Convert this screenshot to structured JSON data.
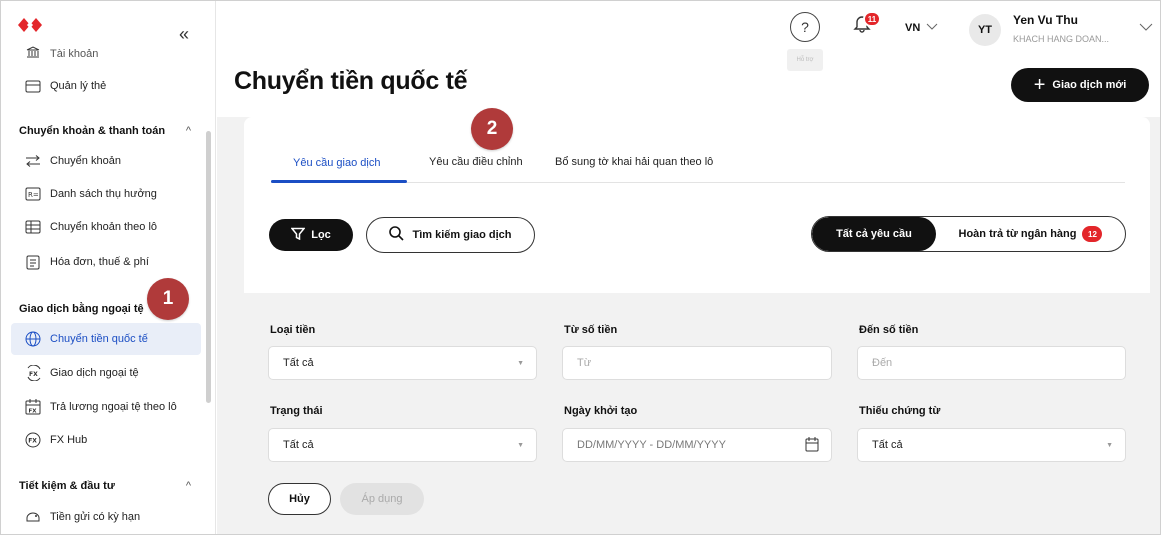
{
  "sidebar": {
    "items": [
      {
        "label": "Tài khoản",
        "icon": "bank-icon"
      },
      {
        "label": "Quản lý thẻ",
        "icon": "card-icon"
      },
      {
        "label": "Chuyển khoản",
        "icon": "transfer-arrows-icon"
      },
      {
        "label": "Danh sách thụ hưởng",
        "icon": "beneficiary-list-icon"
      },
      {
        "label": "Chuyển khoản theo lô",
        "icon": "batch-table-icon"
      },
      {
        "label": "Hóa đơn, thuế & phí",
        "icon": "bill-icon"
      },
      {
        "label": "Chuyển tiền quốc tế",
        "icon": "globe-icon"
      },
      {
        "label": "Giao dịch ngoại tệ",
        "icon": "fx-exchange-icon"
      },
      {
        "label": "Trả lương ngoại tệ theo lô",
        "icon": "fx-calendar-icon"
      },
      {
        "label": "FX Hub",
        "icon": "fx-circle-icon"
      },
      {
        "label": "Tiền gửi có kỳ hạn",
        "icon": "deposit-icon"
      }
    ],
    "sections": [
      {
        "title": "Chuyển khoản & thanh toán",
        "chevron": "^"
      },
      {
        "title": "Giao dịch bằng ngoại tệ",
        "chevron": ""
      },
      {
        "title": "Tiết kiệm & đầu tư",
        "chevron": "^"
      }
    ],
    "collapse": "«"
  },
  "header": {
    "help_symbol": "?",
    "help_tooltip": "Hỗ trợ",
    "notif_count": "11",
    "lang": "VN",
    "avatar": "YT",
    "user_name": "Yen Vu Thu",
    "user_role": "KHACH HANG DOAN..."
  },
  "page": {
    "title": "Chuyển tiền quốc tế",
    "new_button": "Giao dịch mới"
  },
  "tabs": [
    "Yêu cầu giao dịch",
    "Yêu cầu điều chỉnh",
    "Bổ sung tờ khai hải quan theo lô"
  ],
  "toolbar": {
    "filter": "Lọc",
    "search": "Tìm kiếm giao dịch",
    "seg_all": "Tất cả yêu cầu",
    "seg_refund": "Hoàn trả từ ngân hàng",
    "refund_count": "12"
  },
  "form": {
    "currency_label": "Loại tiền",
    "currency_value": "Tất cả",
    "from_label": "Từ số tiền",
    "from_placeholder": "Từ",
    "to_label": "Đến số tiền",
    "to_placeholder": "Đến",
    "status_label": "Trạng thái",
    "status_value": "Tất cả",
    "date_label": "Ngày khởi tạo",
    "date_placeholder": "DD/MM/YYYY - DD/MM/YYYY",
    "missing_label": "Thiếu chứng từ",
    "missing_value": "Tất cả",
    "cancel": "Hủy",
    "apply": "Áp dụng"
  },
  "markers": [
    "1",
    "2"
  ],
  "colors": {
    "brand_red": "#e3262a",
    "accent_blue": "#1b4ec4",
    "marker": "#b03a3a"
  }
}
